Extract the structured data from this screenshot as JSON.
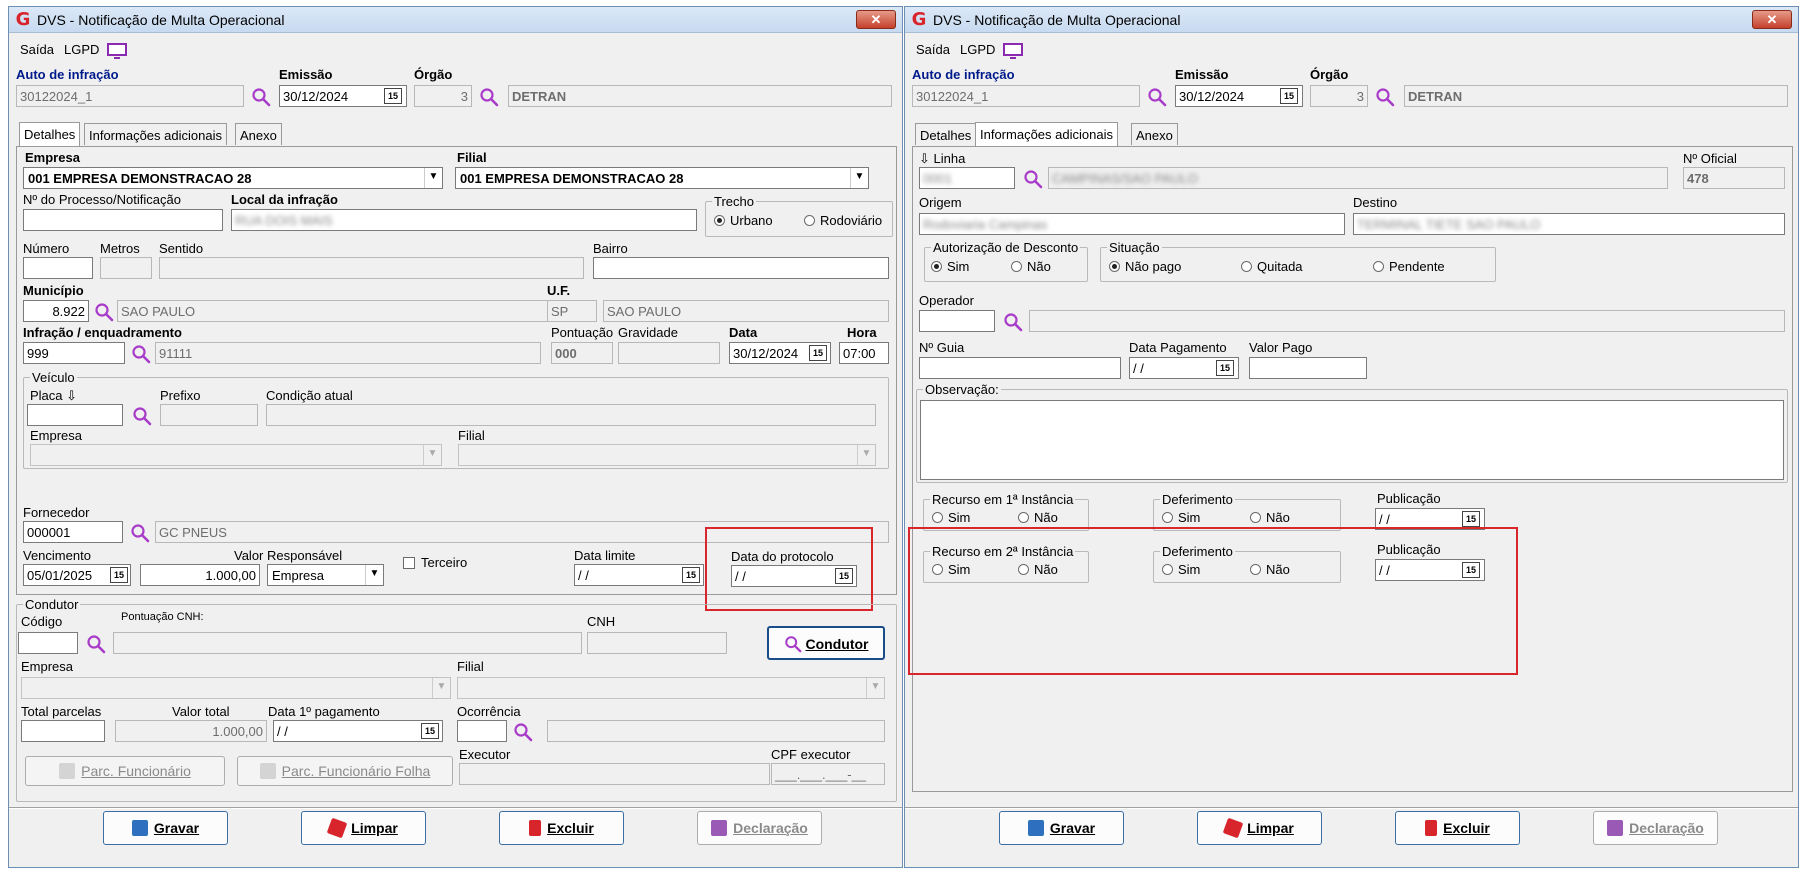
{
  "window": {
    "title": "DVS - Notificação de Multa Operacional",
    "close": "✕",
    "logo": "G"
  },
  "menu": {
    "saida": "Saída",
    "lgpd": "LGPD"
  },
  "header": {
    "auto_label": "Auto de infração",
    "auto_value": "30122024_1",
    "emissao_label": "Emissão",
    "emissao_value": "30/12/2024",
    "orgao_label": "Órgão",
    "orgao_code": "3",
    "orgao_name": "DETRAN",
    "cal": "15"
  },
  "tabs": [
    "Detalhes",
    "Informações adicionais",
    "Anexo"
  ],
  "detalhes": {
    "empresa_label": "Empresa",
    "empresa_value": "001 EMPRESA DEMONSTRACAO 28",
    "filial_label": "Filial",
    "filial_value": "001 EMPRESA DEMONSTRACAO 28",
    "processo_label": "Nº do Processo/Notificação",
    "local_label": "Local da infração",
    "local_value": "RUA DOIS MAIS",
    "trecho_label": "Trecho",
    "urbano": "Urbano",
    "rodoviario": "Rodoviário",
    "numero_label": "Número",
    "metros_label": "Metros",
    "sentido_label": "Sentido",
    "bairro_label": "Bairro",
    "municipio_label": "Município",
    "municipio_code": "8.922",
    "municipio_name": "SAO PAULO",
    "uf_label": "U.F.",
    "uf_value": "SP",
    "uf_name": "SAO PAULO",
    "infracao_label": "Infração / enquadramento",
    "infracao_code": "999",
    "infracao_desc": "91111",
    "pontuacao_label": "Pontuação",
    "pontuacao_value": "000",
    "gravidade_label": "Gravidade",
    "data_label": "Data",
    "data_value": "30/12/2024",
    "hora_label": "Hora",
    "hora_value": "07:00",
    "veiculo_label": "Veículo",
    "placa_label": "Placa ⇩",
    "prefixo_label": "Prefixo",
    "condicao_label": "Condição atual",
    "v_empresa_label": "Empresa",
    "v_filial_label": "Filial",
    "fornecedor_label": "Fornecedor",
    "fornecedor_code": "000001",
    "fornecedor_name": "GC PNEUS",
    "vencimento_label": "Vencimento",
    "vencimento_value": "05/01/2025",
    "valor_label": "Valor",
    "valor_value": "1.000,00",
    "responsavel_label": "Responsável",
    "responsavel_value": "Empresa",
    "terceiro_label": "Terceiro",
    "data_limite_label": "Data limite",
    "data_limite_value": " / /",
    "protocolo_label": "Data do protocolo",
    "protocolo_value": " / /"
  },
  "condutor": {
    "group_label": "Condutor",
    "codigo_label": "Código",
    "pontuacao_cnh_label": "Pontuação CNH:",
    "cnh_label": "CNH",
    "condutor_btn": "Condutor",
    "empresa_label": "Empresa",
    "filial_label": "Filial",
    "total_parcelas_label": "Total parcelas",
    "valor_total_label": "Valor total",
    "valor_total_value": "1.000,00",
    "data_pgto_label": "Data 1º pagamento",
    "data_pgto_value": " / /",
    "ocorrencia_label": "Ocorrência",
    "executor_label": "Executor",
    "cpf_label": "CPF executor",
    "cpf_value": "___.___.___-__",
    "parc_func_btn": "Parc. Funcionário",
    "parc_folha_btn": "Parc. Funcionário Folha"
  },
  "info": {
    "linha_label": "⇩ Linha",
    "linha_code": "0001",
    "linha_desc": "CAMPINAS/SAO PAULO",
    "oficial_label": "Nº Oficial",
    "oficial_value": "478",
    "origem_label": "Origem",
    "origem_value": "Rodoviaria Campinas",
    "destino_label": "Destino",
    "destino_value": "TERMINAL TIETE SAO PAULO",
    "autorizacao_label": "Autorização de Desconto",
    "sim": "Sim",
    "nao": "Não",
    "situacao_label": "Situação",
    "nao_pago": "Não pago",
    "quitada": "Quitada",
    "pendente": "Pendente",
    "operador_label": "Operador",
    "guia_label": "Nº Guia",
    "data_pagamento_label": "Data Pagamento",
    "data_pagamento_value": " / /",
    "valor_pago_label": "Valor Pago",
    "observacao_label": "Observação:",
    "recurso1_label": "Recurso em 1ª Instância",
    "recurso2_label": "Recurso em 2ª Instância",
    "deferimento_label": "Deferimento",
    "publicacao_label": "Publicação",
    "publicacao_value": " / /"
  },
  "footer": {
    "gravar": "Gravar",
    "limpar": "Limpar",
    "excluir": "Excluir",
    "declaracao": "Declaração"
  },
  "colors": {
    "accent_blue": "#001a8c",
    "highlight_red": "#d9262c",
    "magnifier": "#a83cc8"
  }
}
